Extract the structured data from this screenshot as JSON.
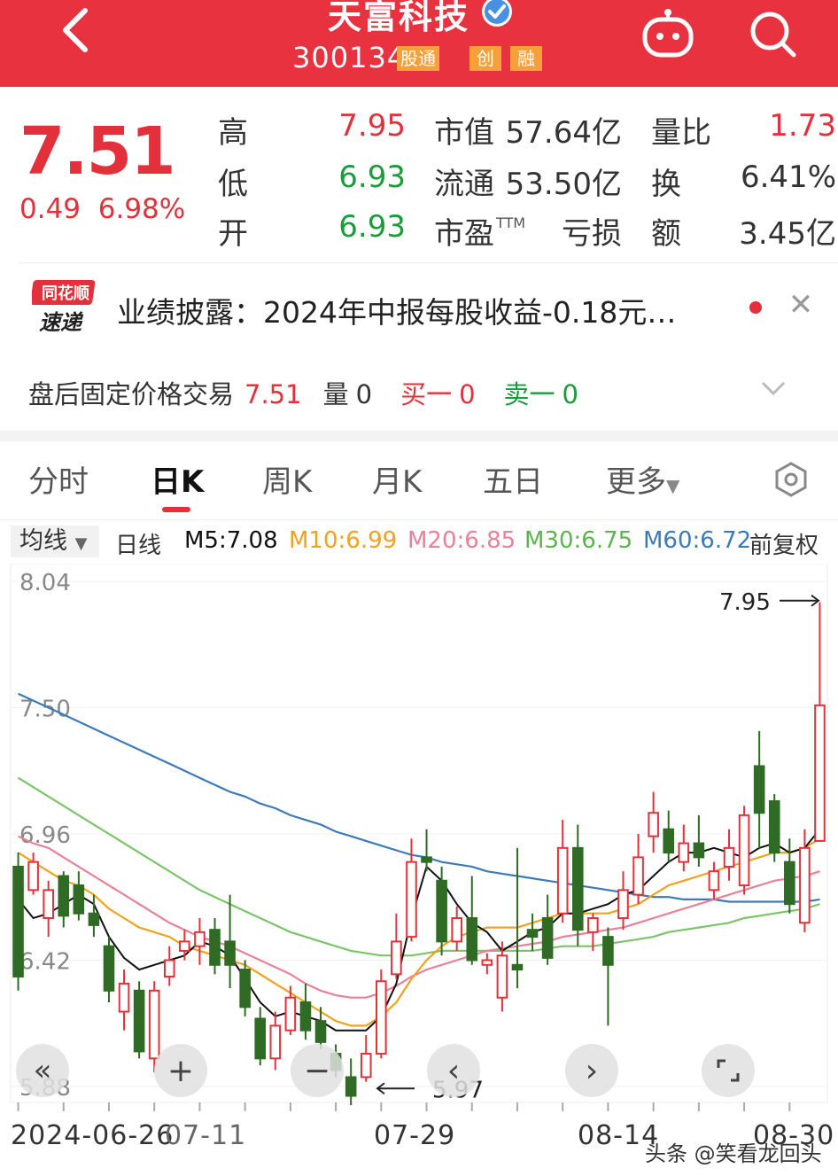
{
  "header": {
    "title": "天富科技",
    "code": "300134",
    "tag_tong": "股通",
    "tag_chuang": "创",
    "tag_rong": "融",
    "accent": "#e8323f"
  },
  "quote": {
    "price": "7.51",
    "change": "0.49",
    "change_pct": "6.98%",
    "rows": [
      {
        "l1": "高",
        "v1": "7.95",
        "c1": "red",
        "l2": "市值",
        "v2": "57.64亿",
        "l3": "量比",
        "v3": "1.73",
        "c3": "red"
      },
      {
        "l1": "低",
        "v1": "6.93",
        "c1": "green",
        "l2": "流通",
        "v2": "53.50亿",
        "l3": "换",
        "v3": "6.41%",
        "c3": "dark"
      },
      {
        "l1": "开",
        "v1": "6.93",
        "c1": "green",
        "l2": "市盈",
        "l2_sup": "TTM",
        "v2": "亏损",
        "l3": "额",
        "v3": "3.45亿",
        "c3": "dark"
      }
    ]
  },
  "news": {
    "logo_top": "同花顺",
    "logo_bottom": "速递",
    "text": "业绩披露：2024年中报每股收益-0.18元…"
  },
  "after_hours": {
    "label": "盘后固定价格交易",
    "price": "7.51",
    "vol_label": "量",
    "vol": "0",
    "buy_label": "买一",
    "buy": "0",
    "sell_label": "卖一",
    "sell": "0"
  },
  "tabs": [
    "分时",
    "日K",
    "周K",
    "月K",
    "五日",
    "更多"
  ],
  "ma_legend": {
    "select": "均线",
    "daily": "日线",
    "m5": "M5:7.08",
    "m10": "M10:6.99",
    "m20": "M20:6.85",
    "m30": "M30:6.75",
    "m60": "M60:6.72",
    "adjust": "前复权",
    "colors": {
      "m5": "#111111",
      "m10": "#f0a21f",
      "m20": "#e8819a",
      "m30": "#7cc46a",
      "m60": "#3d7ab8"
    }
  },
  "chart_data": {
    "type": "candlestick",
    "y_ticks": [
      "8.04",
      "7.50",
      "6.96",
      "6.42",
      "5.88"
    ],
    "ylim": [
      5.88,
      8.04
    ],
    "high_label": "7.95",
    "low_label": "5.97",
    "x_labels": [
      "2024-06-26",
      "07-11",
      "07-29",
      "08-14",
      "08-30"
    ],
    "candles": [
      [
        6.82,
        6.35,
        6.88,
        6.29
      ],
      [
        6.72,
        6.84,
        6.88,
        6.7
      ],
      [
        6.6,
        6.72,
        6.76,
        6.52
      ],
      [
        6.78,
        6.61,
        6.8,
        6.56
      ],
      [
        6.74,
        6.62,
        6.8,
        6.59
      ],
      [
        6.62,
        6.57,
        6.7,
        6.52
      ],
      [
        6.48,
        6.29,
        6.52,
        6.24
      ],
      [
        6.2,
        6.32,
        6.38,
        6.12
      ],
      [
        6.29,
        6.03,
        6.33,
        6.0
      ],
      [
        6.0,
        6.29,
        6.33,
        5.94
      ],
      [
        6.35,
        6.42,
        6.48,
        6.31
      ],
      [
        6.46,
        6.5,
        6.55,
        6.42
      ],
      [
        6.48,
        6.54,
        6.6,
        6.4
      ],
      [
        6.55,
        6.4,
        6.6,
        6.36
      ],
      [
        6.5,
        6.4,
        6.7,
        6.3
      ],
      [
        6.38,
        6.22,
        6.42,
        6.18
      ],
      [
        6.17,
        6.0,
        6.22,
        5.97
      ],
      [
        6.0,
        6.14,
        6.2,
        5.95
      ],
      [
        6.12,
        6.26,
        6.31,
        6.1
      ],
      [
        6.24,
        6.12,
        6.32,
        6.08
      ],
      [
        6.16,
        6.07,
        6.22,
        6.04
      ],
      [
        6.02,
        5.95,
        6.06,
        5.92
      ],
      [
        5.92,
        5.84,
        6.0,
        5.8
      ],
      [
        5.92,
        6.02,
        6.1,
        5.9
      ],
      [
        6.02,
        6.33,
        6.38,
        6.0
      ],
      [
        6.36,
        6.5,
        6.62,
        6.34
      ],
      [
        6.52,
        6.84,
        6.94,
        6.5
      ],
      [
        6.86,
        6.84,
        6.98,
        6.8
      ],
      [
        6.76,
        6.5,
        6.82,
        6.44
      ],
      [
        6.5,
        6.6,
        6.65,
        6.46
      ],
      [
        6.6,
        6.42,
        6.78,
        6.4
      ],
      [
        6.4,
        6.42,
        6.45,
        6.36
      ],
      [
        6.26,
        6.44,
        6.5,
        6.2
      ],
      [
        6.4,
        6.38,
        6.9,
        6.3
      ],
      [
        6.55,
        6.52,
        6.62,
        6.46
      ],
      [
        6.6,
        6.43,
        6.7,
        6.4
      ],
      [
        6.62,
        6.9,
        7.02,
        6.58
      ],
      [
        6.9,
        6.55,
        7.0,
        6.48
      ],
      [
        6.54,
        6.6,
        6.62,
        6.46
      ],
      [
        6.52,
        6.4,
        6.56,
        6.14
      ],
      [
        6.6,
        6.72,
        6.8,
        6.55
      ],
      [
        6.7,
        6.86,
        6.96,
        6.66
      ],
      [
        6.95,
        7.05,
        7.14,
        6.88
      ],
      [
        6.98,
        6.88,
        7.06,
        6.84
      ],
      [
        6.84,
        6.92,
        7.0,
        6.8
      ],
      [
        6.92,
        6.86,
        7.04,
        6.82
      ],
      [
        6.72,
        6.8,
        6.84,
        6.68
      ],
      [
        6.82,
        6.9,
        6.98,
        6.76
      ],
      [
        6.74,
        7.04,
        7.08,
        6.7
      ],
      [
        7.25,
        7.05,
        7.4,
        6.9
      ],
      [
        7.1,
        6.88,
        7.13,
        6.84
      ],
      [
        6.84,
        6.66,
        6.94,
        6.62
      ],
      [
        6.58,
        6.9,
        6.98,
        6.54
      ],
      [
        6.93,
        7.51,
        7.95,
        6.93
      ]
    ],
    "ma5": [
      6.68,
      6.6,
      6.62,
      6.66,
      6.7,
      6.66,
      6.52,
      6.43,
      6.38,
      6.4,
      6.42,
      6.44,
      6.5,
      6.48,
      6.44,
      6.34,
      6.24,
      6.18,
      6.2,
      6.18,
      6.16,
      6.12,
      6.12,
      6.12,
      6.18,
      6.32,
      6.6,
      6.82,
      6.76,
      6.66,
      6.58,
      6.54,
      6.46,
      6.5,
      6.54,
      6.56,
      6.62,
      6.62,
      6.64,
      6.66,
      6.7,
      6.72,
      6.78,
      6.84,
      6.88,
      6.88,
      6.9,
      6.88,
      6.86,
      6.9,
      6.92,
      6.88,
      6.9,
      6.98
    ],
    "ma10": [
      6.88,
      6.84,
      6.8,
      6.76,
      6.74,
      6.7,
      6.64,
      6.6,
      6.56,
      6.54,
      6.52,
      6.48,
      6.46,
      6.44,
      6.42,
      6.4,
      6.36,
      6.32,
      6.28,
      6.24,
      6.2,
      6.16,
      6.14,
      6.14,
      6.18,
      6.24,
      6.34,
      6.42,
      6.48,
      6.52,
      6.54,
      6.56,
      6.56,
      6.56,
      6.58,
      6.6,
      6.62,
      6.62,
      6.62,
      6.62,
      6.64,
      6.66,
      6.7,
      6.74,
      6.76,
      6.78,
      6.8,
      6.82,
      6.84,
      6.86,
      6.88,
      6.88,
      6.9,
      6.94
    ],
    "ma20": [
      6.95,
      6.92,
      6.9,
      6.86,
      6.82,
      6.78,
      6.74,
      6.7,
      6.66,
      6.62,
      6.58,
      6.55,
      6.52,
      6.5,
      6.48,
      6.45,
      6.42,
      6.39,
      6.36,
      6.32,
      6.29,
      6.27,
      6.26,
      6.26,
      6.28,
      6.31,
      6.35,
      6.38,
      6.4,
      6.42,
      6.44,
      6.46,
      6.47,
      6.48,
      6.49,
      6.5,
      6.52,
      6.53,
      6.54,
      6.55,
      6.56,
      6.58,
      6.6,
      6.62,
      6.64,
      6.66,
      6.68,
      6.7,
      6.72,
      6.74,
      6.76,
      6.77,
      6.78,
      6.8
    ],
    "ma30": [
      7.2,
      7.16,
      7.12,
      7.08,
      7.04,
      7.0,
      6.96,
      6.92,
      6.88,
      6.84,
      6.8,
      6.76,
      6.72,
      6.69,
      6.66,
      6.63,
      6.6,
      6.57,
      6.54,
      6.52,
      6.5,
      6.48,
      6.46,
      6.45,
      6.44,
      6.44,
      6.44,
      6.45,
      6.46,
      6.46,
      6.46,
      6.46,
      6.46,
      6.46,
      6.46,
      6.47,
      6.48,
      6.48,
      6.48,
      6.49,
      6.5,
      6.51,
      6.52,
      6.54,
      6.55,
      6.56,
      6.57,
      6.58,
      6.6,
      6.61,
      6.62,
      6.63,
      6.64,
      6.66
    ],
    "ma60": [
      7.56,
      7.53,
      7.5,
      7.47,
      7.44,
      7.41,
      7.38,
      7.35,
      7.32,
      7.29,
      7.26,
      7.23,
      7.2,
      7.17,
      7.14,
      7.12,
      7.09,
      7.07,
      7.04,
      7.02,
      7.0,
      6.97,
      6.95,
      6.93,
      6.91,
      6.89,
      6.87,
      6.86,
      6.84,
      6.83,
      6.82,
      6.8,
      6.79,
      6.78,
      6.77,
      6.76,
      6.75,
      6.74,
      6.73,
      6.72,
      6.71,
      6.7,
      6.69,
      6.69,
      6.68,
      6.68,
      6.68,
      6.67,
      6.67,
      6.67,
      6.67,
      6.67,
      6.67,
      6.68
    ]
  },
  "watermark": "头条 @笑看龙回头"
}
